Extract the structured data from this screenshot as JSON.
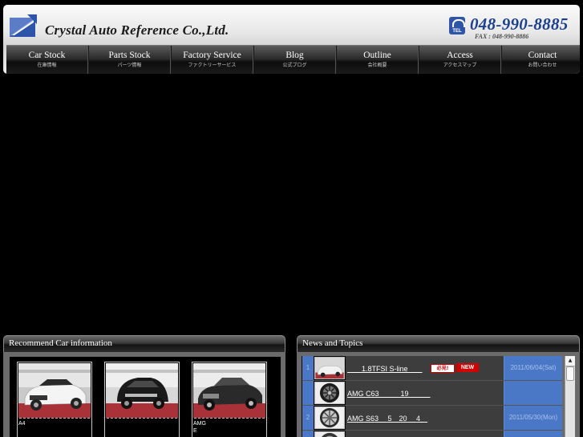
{
  "header": {
    "company_name": "Crystal Auto Reference Co.,Ltd.",
    "tel_icon_label": "TEL",
    "phone": "048-990-8885",
    "fax": "FAX : 048-990-8886"
  },
  "nav": {
    "items": [
      {
        "en": "Car Stock",
        "ja": "在庫情報"
      },
      {
        "en": "Parts Stock",
        "ja": "パーツ情報"
      },
      {
        "en": "Factory Service",
        "ja": "ファクトリーサービス"
      },
      {
        "en": "Blog",
        "ja": "公式ブログ"
      },
      {
        "en": "Outline",
        "ja": "会社概要"
      },
      {
        "en": "Access",
        "ja": "アクセスマップ"
      },
      {
        "en": "Contact",
        "ja": "お問い合わせ"
      }
    ]
  },
  "recommend": {
    "title": "Recommend Car information",
    "cars": [
      {
        "caption_line1": "",
        "caption_line2": "A4"
      },
      {
        "caption_line1": "",
        "caption_line2": ""
      },
      {
        "caption_line1": "AMG",
        "caption_line2": "E"
      }
    ]
  },
  "news": {
    "title": "News and Topics",
    "rows": [
      {
        "num": "1",
        "title": "　　1.8TFSI S-line　　",
        "date": "2011/06/04(Sat)",
        "badge_must": "必見!",
        "badge_new": "NEW"
      },
      {
        "num": "",
        "title": "AMG C63　　　19　　　",
        "date": ""
      },
      {
        "num": "2",
        "title": "AMG S63　 5　20　 4　",
        "date": "2011/05/30(Mon)"
      },
      {
        "num": "",
        "title": "",
        "date": ""
      }
    ]
  },
  "colors": {
    "accent_blue": "#4a78c6",
    "phone_blue": "#1c3f8e",
    "badge_red": "#d20000"
  }
}
